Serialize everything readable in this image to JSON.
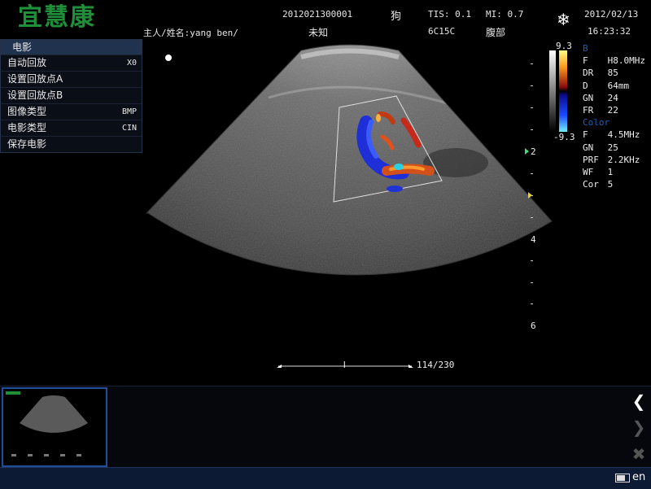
{
  "header": {
    "logo": "宜慧康",
    "patient_id": "2012021300001",
    "species": "狗",
    "tis": "TIS: 0.1",
    "mi": "MI: 0.7",
    "date": "2012/02/13",
    "owner_name": "主人/姓名:yang ben/",
    "unknown": "未知",
    "probe": "6C15C",
    "exam": "腹部",
    "time": "16:23:32",
    "freeze_icon": "❄"
  },
  "cine_menu": {
    "title": "电影",
    "items": [
      {
        "label": "自动回放",
        "value": "X0"
      },
      {
        "label": "设置回放点A",
        "value": ""
      },
      {
        "label": "设置回放点B",
        "value": ""
      },
      {
        "label": "图像类型",
        "value": "BMP"
      },
      {
        "label": "电影类型",
        "value": "CIN"
      },
      {
        "label": "保存电影",
        "value": ""
      }
    ]
  },
  "colorbar": {
    "max": "9.3",
    "min": "-9.3"
  },
  "params": {
    "b_title": "B",
    "b": [
      {
        "k": "F",
        "v": "H8.0MHz"
      },
      {
        "k": "DR",
        "v": "85"
      },
      {
        "k": "D",
        "v": "64mm"
      },
      {
        "k": "GN",
        "v": "24"
      },
      {
        "k": "FR",
        "v": "22"
      }
    ],
    "color_title": "Color",
    "color": [
      {
        "k": "F",
        "v": "4.5MHz"
      },
      {
        "k": "GN",
        "v": "25"
      },
      {
        "k": "PRF",
        "v": "2.2KHz"
      },
      {
        "k": "WF",
        "v": "1"
      },
      {
        "k": "Cor",
        "v": "5"
      }
    ]
  },
  "depth_scale": {
    "labels": [
      "2",
      "4",
      "6"
    ]
  },
  "cine": {
    "frame": "114/230",
    "progress": 0.4957
  },
  "bottom": {
    "lang": "en"
  },
  "colors": {
    "logo_green": "#1f8f3a",
    "menu_title_bg": "#20324e",
    "bar_blue": "#0d1a33",
    "param_section": "#1c5fb8"
  }
}
